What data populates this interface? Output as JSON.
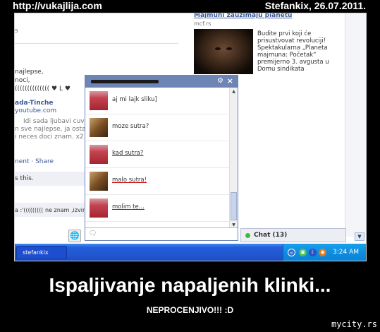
{
  "header": {
    "site": "http://vukajlija.com",
    "credit": "Stefankix, 26.07.2011."
  },
  "ad": {
    "title": "Majmuni zauzimaju planetu",
    "url": "mcf.rs",
    "text": "Budite prvi koji će prisustvovat revoluciji! Spektakularna „Planeta majmuna: Početak“ premijerno 3. avgusta u Domu sindikata"
  },
  "feed": {
    "line_s": "s",
    "line1": "najlepse,",
    "line2": "noci,",
    "line3": "((((((((((((((  ♥ L ♥",
    "author": "ada-Tinche",
    "source": "youtube.com",
    "snippet1": "Idi sada ljubavi cuvaj se",
    "snippet2": "n sve najlepse, ja ostajem",
    "snippet3": "i neces doci znam. x2 P",
    "actions": "nent · Share",
    "like_this": "s this.",
    "comment": "a :'(((((((((  ne znam ,izvin"
  },
  "chat": {
    "close_icon": "×",
    "gear_icon": "⚙",
    "messages": [
      {
        "avatar": "red",
        "text": "aj mi lajk sliku]"
      },
      {
        "avatar": "tan",
        "text": "moze sutra?"
      },
      {
        "avatar": "red",
        "text": "kad sutra?"
      },
      {
        "avatar": "tan",
        "text": "malo sutra!"
      },
      {
        "avatar": "red",
        "text": "molim te..."
      }
    ]
  },
  "chat_bar": {
    "label": "Chat (13)"
  },
  "taskbar": {
    "task_label": "stefankix",
    "time": "3:24 AM"
  },
  "caption": {
    "title": "Ispaljivanje napaljenih klinki...",
    "subtitle": "NEPROCENJIVO!!! :D",
    "watermark": "mycity.rs"
  }
}
